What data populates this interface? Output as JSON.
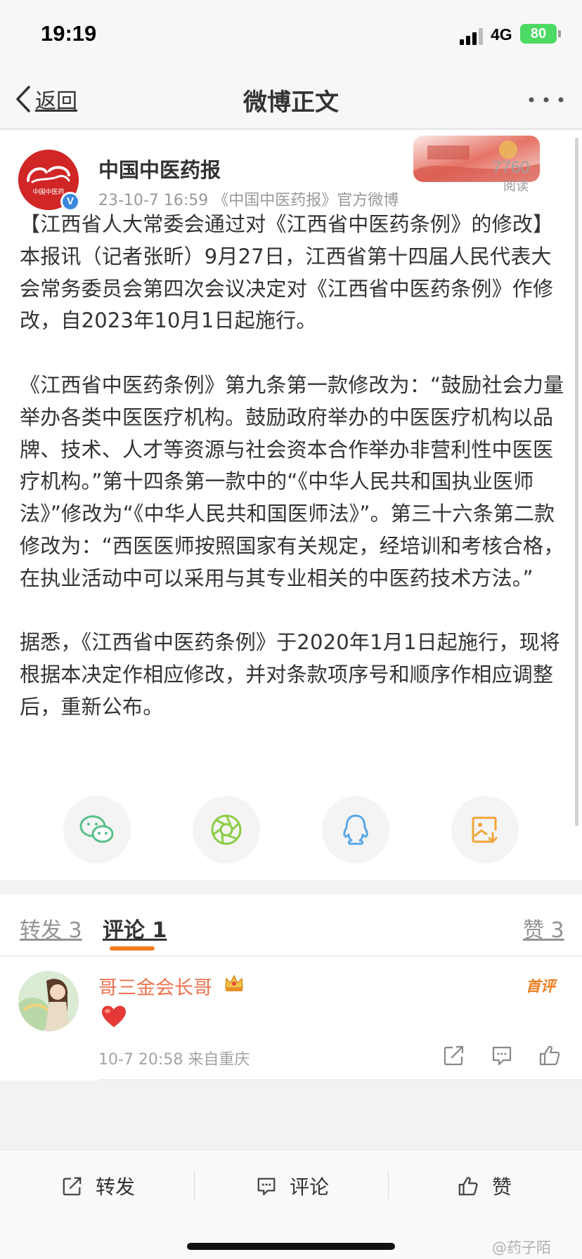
{
  "status": {
    "time": "19:19",
    "network": "4G",
    "battery": "80"
  },
  "nav": {
    "back_label": "返回",
    "title": "微博正文"
  },
  "post": {
    "author": "中国中医药报",
    "avatar_text": "中国中医药",
    "meta": "23-10-7 16:59 《中国中医药报》官方微博",
    "read_count": "7760",
    "read_label": "阅读",
    "paragraphs": [
      "【江西省人大常委会通过对《江西省中医药条例》的修改】本报讯（记者张昕）9月27日，江西省第十四届人民代表大会常务委员会第四次会议决定对《江西省中医药条例》作修改，自2023年10月1日起施行。",
      "《江西省中医药条例》第九条第一款修改为：“鼓励社会力量举办各类中医医疗机构。鼓励政府举办的中医医疗机构以品牌、技术、人才等资源与社会资本合作举办非营利性中医医疗机构。”第十四条第一款中的“《中华人民共和国执业医师法》”修改为“《中华人民共和国医师法》”。第三十六条第二款修改为：“西医医师按照国家有关规定，经培训和考核合格，在执业活动中可以采用与其专业相关的中医药技术方法。”",
      "据悉，《江西省中医药条例》于2020年1月1日起施行，现将根据本决定作相应修改，并对条款项序号和顺序作相应调整后，重新公布。"
    ]
  },
  "share_icons": [
    "wechat-icon",
    "moments-icon",
    "qq-icon",
    "save-image-icon"
  ],
  "tabs": {
    "repost": "转发 3",
    "comment": "评论 1",
    "like": "赞 3"
  },
  "comment": {
    "name": "哥三金会长哥",
    "badge": "首评",
    "content_icon": "heart-icon",
    "meta": "10-7 20:58 来自重庆"
  },
  "toolbar": {
    "repost": "转发",
    "comment": "评论",
    "like": "赞"
  },
  "watermark": "@药子陌",
  "colors": {
    "accent": "#f07e1e",
    "name": "#eb7350",
    "battery": "#4cd964"
  }
}
